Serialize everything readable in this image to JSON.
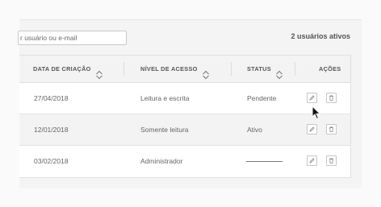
{
  "search": {
    "placeholder": "r usuário ou e-mail"
  },
  "user_count": "2 usuários ativos",
  "table": {
    "headers": {
      "created": "DATA DE CRIAÇÃO",
      "access": "NÍVEL DE ACESSO",
      "status": "STATUS",
      "actions": "AÇÕES"
    },
    "rows": [
      {
        "created": "27/04/2018",
        "access": "Leitura e escrita",
        "status": "Pendente"
      },
      {
        "created": "12/01/2018",
        "access": "Somente leitura",
        "status": "Ativo"
      },
      {
        "created": "03/02/2018",
        "access": "Administrador",
        "status": ""
      }
    ]
  },
  "icons": {
    "edit": "pencil-icon",
    "delete": "trash-icon",
    "sort": "sort-arrows-icon",
    "cursor": "mouse-pointer-icon"
  },
  "colors": {
    "panel": "#f4f4f4",
    "header": "#f3f3f3",
    "row_alt": "#f3f3f3",
    "text": "#555555"
  }
}
